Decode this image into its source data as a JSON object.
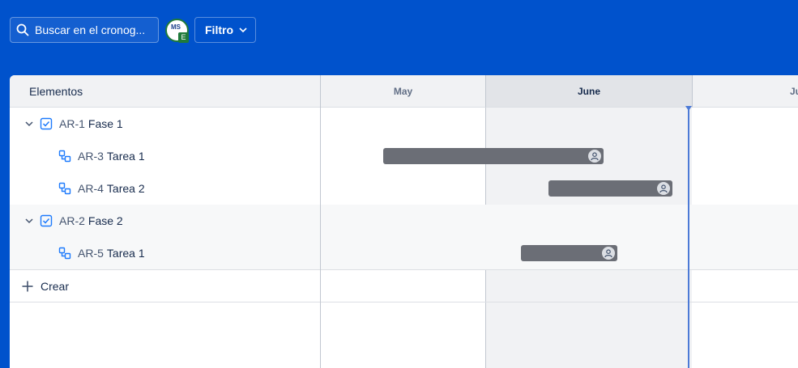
{
  "toolbar": {
    "search_placeholder": "Buscar en el cronog...",
    "avatar_initials": "MS",
    "avatar_badge": "E",
    "filter_label": "Filtro"
  },
  "timeline": {
    "items_header": "Elementos",
    "months": [
      "May",
      "June",
      "Ju"
    ],
    "current_month": "June"
  },
  "rows": [
    {
      "key": "AR-1",
      "title": "Fase 1",
      "type": "epic",
      "expanded": true
    },
    {
      "key": "AR-3",
      "title": "Tarea 1",
      "type": "subtask"
    },
    {
      "key": "AR-4",
      "title": "Tarea 2",
      "type": "subtask"
    },
    {
      "key": "AR-2",
      "title": "Fase 2",
      "type": "epic",
      "expanded": true
    },
    {
      "key": "AR-5",
      "title": "Tarea 1",
      "type": "subtask"
    }
  ],
  "create_label": "Crear",
  "colors": {
    "topbar": "#0052cc",
    "bar": "#6b6e76",
    "today_marker": "#4c7ad6",
    "checkbox_icon": "#1d7afc"
  }
}
